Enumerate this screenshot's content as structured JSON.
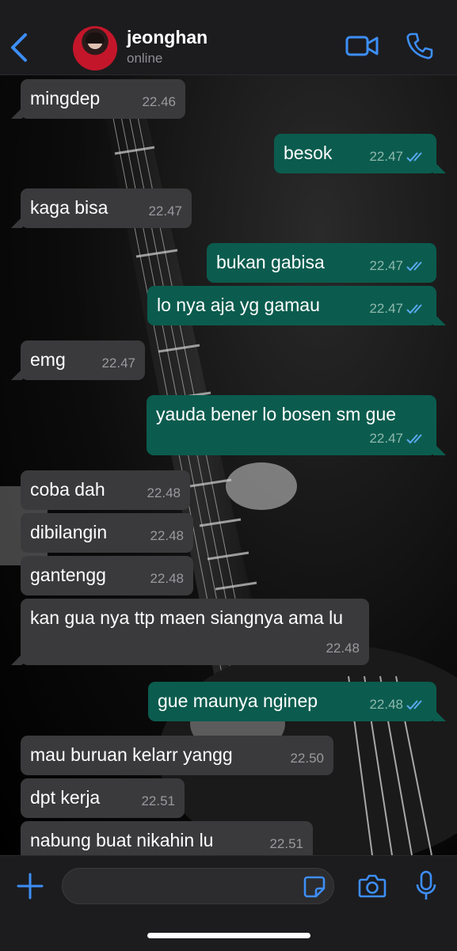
{
  "header": {
    "contact_name": "jeonghan",
    "status": "online"
  },
  "messages": [
    {
      "dir": "in",
      "text": "mingdep",
      "time": "22.46"
    },
    {
      "dir": "out",
      "text": "besok",
      "time": "22.47"
    },
    {
      "dir": "in",
      "text": "kaga bisa",
      "time": "22.47"
    },
    {
      "dir": "out",
      "text": "bukan gabisa",
      "time": "22.47"
    },
    {
      "dir": "out",
      "text": "lo nya aja yg gamau",
      "time": "22.47"
    },
    {
      "dir": "in",
      "text": "emg",
      "time": "22.47"
    },
    {
      "dir": "out",
      "text": "yauda bener lo bosen sm gue",
      "time": "22.47"
    },
    {
      "dir": "in",
      "text": "coba dah",
      "time": "22.48"
    },
    {
      "dir": "in",
      "text": "dibilangin",
      "time": "22.48"
    },
    {
      "dir": "in",
      "text": "gantengg",
      "time": "22.48"
    },
    {
      "dir": "in",
      "text": "kan gua nya ttp maen siangnya ama lu",
      "time": "22.48"
    },
    {
      "dir": "out",
      "text": "gue maunya nginep",
      "time": "22.48"
    },
    {
      "dir": "in",
      "text": "mau buruan kelarr yangg",
      "time": "22.50"
    },
    {
      "dir": "in",
      "text": "dpt kerja",
      "time": "22.51"
    },
    {
      "dir": "in",
      "text": "nabung buat nikahin lu",
      "time": "22.51"
    }
  ],
  "colors": {
    "accent": "#3d8ef7",
    "incoming_bubble": "#3a3a3c",
    "outgoing_bubble": "#0b5c4e",
    "read_ticks": "#5aa9f0"
  },
  "icons": {
    "back": "chevron-left-icon",
    "video": "video-camera-icon",
    "call": "phone-icon",
    "attach": "plus-icon",
    "sticker": "sticker-icon",
    "camera": "camera-icon",
    "mic": "microphone-icon"
  }
}
